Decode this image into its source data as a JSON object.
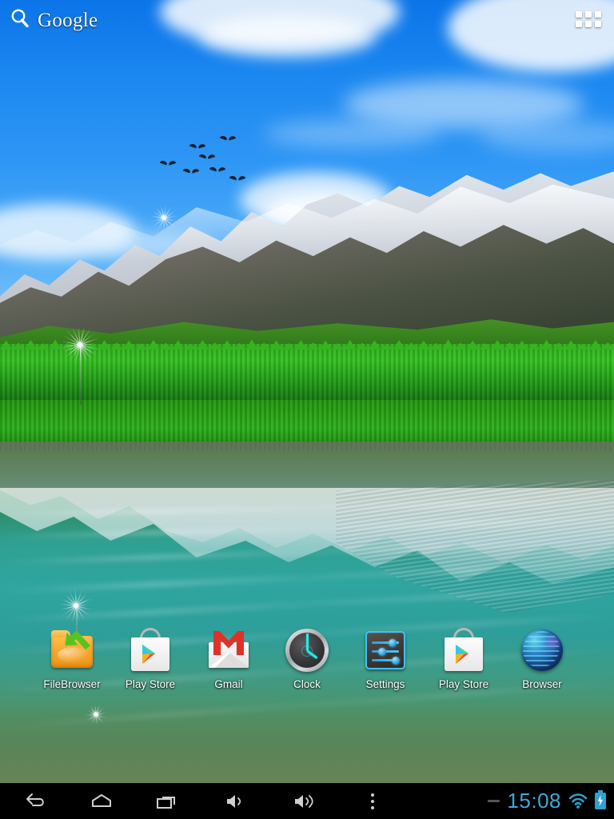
{
  "device": {
    "platform": "android-tablet-home-screen",
    "resolution": "768x1024"
  },
  "home": {
    "search_widget": {
      "label": "Google",
      "icon": "search-magnifier-icon"
    },
    "apps_button": {
      "icon": "app-drawer-grid-icon",
      "label": "Apps"
    },
    "wallpaper": {
      "name": "mountain-lake-reflection-wallpaper",
      "sky_color": "#1b87f0",
      "forest_color": "#33c020",
      "water_color": "#2fa5a0",
      "elements": [
        "blue-sky",
        "white-clouds",
        "bird-flock",
        "snow-mountains",
        "green-forest",
        "turquoise-lake",
        "mirror-reflection",
        "dandelion-seeds"
      ]
    },
    "dock": {
      "apps": [
        {
          "label": "FileBrowser",
          "icon": "file-browser-folder-icon",
          "color": "#f7a82e"
        },
        {
          "label": "Play Store",
          "icon": "play-store-bag-icon",
          "color": "#ffffff"
        },
        {
          "label": "Gmail",
          "icon": "gmail-envelope-icon",
          "color": "#e03127"
        },
        {
          "label": "Clock",
          "icon": "clock-analog-icon",
          "color": "#2ee6e6"
        },
        {
          "label": "Settings",
          "icon": "settings-sliders-icon",
          "color": "#3fc2f5"
        },
        {
          "label": "Play Store",
          "icon": "play-store-bag-icon",
          "color": "#ffffff"
        },
        {
          "label": "Browser",
          "icon": "browser-globe-icon",
          "color": "#2a84c4"
        }
      ]
    }
  },
  "navbar": {
    "buttons": [
      {
        "name": "back",
        "icon": "back-arrow-icon"
      },
      {
        "name": "home",
        "icon": "home-icon"
      },
      {
        "name": "recents",
        "icon": "recent-apps-icon"
      },
      {
        "name": "volume-down",
        "icon": "volume-down-icon"
      },
      {
        "name": "volume-up",
        "icon": "volume-up-icon"
      },
      {
        "name": "menu",
        "icon": "overflow-menu-icon"
      }
    ],
    "status": {
      "notification_dash": "—",
      "time": "15:08",
      "wifi": {
        "icon": "wifi-icon",
        "bars": 3
      },
      "battery": {
        "icon": "battery-charging-icon",
        "charging": true
      },
      "accent_color": "#3ea8d8"
    }
  }
}
